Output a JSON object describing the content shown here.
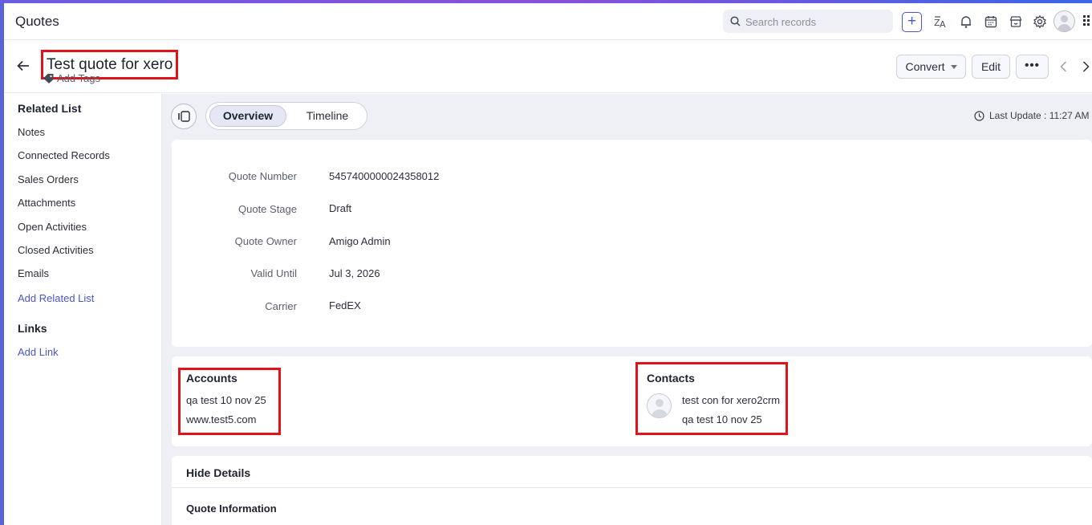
{
  "app": {
    "module_title": "Quotes",
    "search_placeholder": "Search records",
    "add_label": "+"
  },
  "record": {
    "title": "Test quote for xero",
    "add_tags": "Add Tags",
    "convert_label": "Convert",
    "edit_label": "Edit",
    "more_label": "•••"
  },
  "sidebar": {
    "related_heading": "Related List",
    "items": [
      {
        "label": "Notes"
      },
      {
        "label": "Connected Records"
      },
      {
        "label": "Sales Orders"
      },
      {
        "label": "Attachments"
      },
      {
        "label": "Open Activities"
      },
      {
        "label": "Closed Activities"
      },
      {
        "label": "Emails"
      }
    ],
    "add_related": "Add Related List",
    "links_heading": "Links",
    "add_link": "Add Link"
  },
  "tabs": [
    {
      "label": "Overview",
      "active": true
    },
    {
      "label": "Timeline",
      "active": false
    }
  ],
  "last_update": "Last Update : 11:27 AM",
  "details": [
    {
      "label": "Quote Number",
      "value": "5457400000024358012"
    },
    {
      "label": "Quote Stage",
      "value": "Draft"
    },
    {
      "label": "Quote Owner",
      "value": "Amigo Admin"
    },
    {
      "label": "Valid Until",
      "value": "Jul 3, 2026"
    },
    {
      "label": "Carrier",
      "value": "FedEX"
    }
  ],
  "accounts": {
    "title": "Accounts",
    "name": "qa test 10 nov 25",
    "website": "www.test5.com"
  },
  "contacts": {
    "title": "Contacts",
    "name": "test con for xero2crm",
    "account": "qa test 10 nov 25"
  },
  "sections": {
    "hide_details": "Hide Details",
    "quote_information": "Quote Information"
  },
  "colors": {
    "accent": "#4a55c8",
    "highlight": "#e0121a",
    "main_bg": "#eef0f6"
  }
}
